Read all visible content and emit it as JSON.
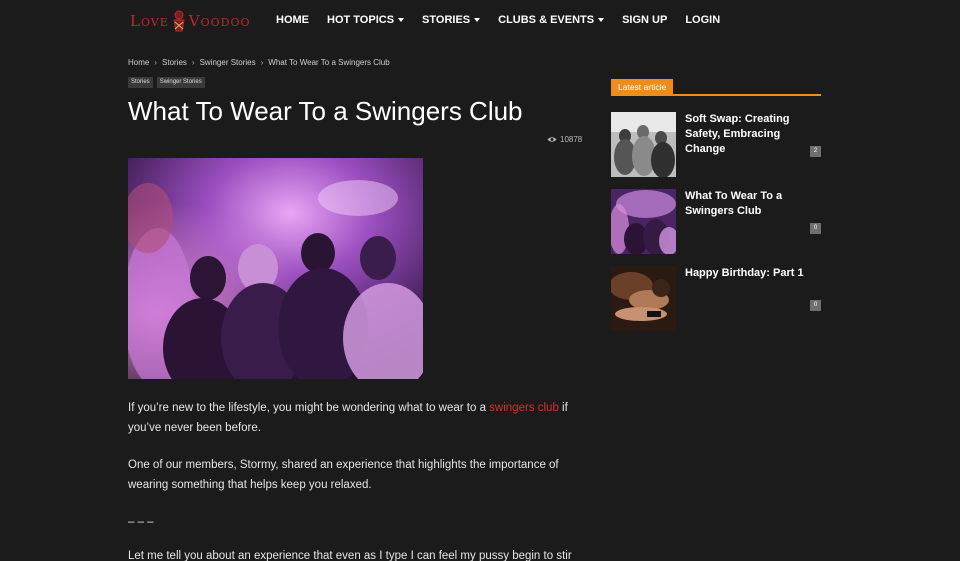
{
  "brand": {
    "name_left": "Love",
    "name_right": "Voodoo"
  },
  "nav": {
    "items": [
      {
        "label": "HOME",
        "dropdown": false
      },
      {
        "label": "HOT TOPICS",
        "dropdown": true
      },
      {
        "label": "STORIES",
        "dropdown": true
      },
      {
        "label": "CLUBS & EVENTS",
        "dropdown": true
      },
      {
        "label": "SIGN UP",
        "dropdown": false
      },
      {
        "label": "LOGIN",
        "dropdown": false
      }
    ]
  },
  "breadcrumb": [
    "Home",
    "Stories",
    "Swinger Stories",
    "What To Wear To a Swingers Club"
  ],
  "tags": [
    "Stories",
    "Swinger Stories"
  ],
  "article": {
    "title": "What To Wear To a Swingers Club",
    "views": "10878",
    "p1_before": "If you’re new to the lifestyle, you might be wondering what to wear to a ",
    "p1_link": "swingers club",
    "p1_after": " if you’ve never been before.",
    "p2": "One of our members, Stormy, shared an experience that highlights the importance of wearing something that helps keep you relaxed.",
    "p3": "– – –",
    "p4": "Let me tell you about an experience that even as I type I can feel my pussy begin to stir"
  },
  "sidebar": {
    "heading": "Latest article",
    "articles": [
      {
        "title": "Soft Swap: Creating Safety, Embracing Change",
        "count": "2"
      },
      {
        "title": "What To Wear To a Swingers Club",
        "count": "0"
      },
      {
        "title": "Happy Birthday: Part 1",
        "count": "0"
      }
    ]
  },
  "colors": {
    "accent": "#ef8d1c",
    "link": "#d62f2f",
    "logo": "#c1272d",
    "background": "#1b1b1b"
  }
}
